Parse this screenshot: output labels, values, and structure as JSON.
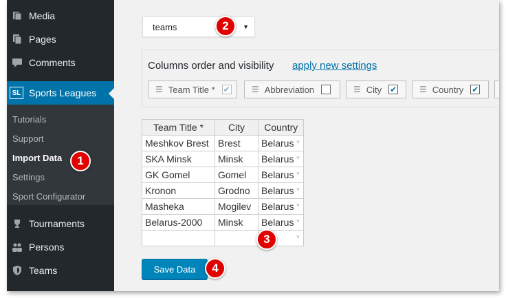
{
  "sidebar": {
    "menu": [
      {
        "label": "Media",
        "icon": "media-icon"
      },
      {
        "label": "Pages",
        "icon": "pages-icon"
      },
      {
        "label": "Comments",
        "icon": "comments-icon"
      },
      {
        "label": "Sports Leagues",
        "icon": "sl-logo-icon",
        "badge": "SL",
        "active": true
      }
    ],
    "submenu": [
      "Tutorials",
      "Support",
      "Import Data",
      "Settings",
      "Sport Configurator"
    ],
    "current_submenu": "Import Data",
    "menu_bottom": [
      {
        "label": "Tournaments",
        "icon": "trophy-icon"
      },
      {
        "label": "Persons",
        "icon": "persons-icon"
      },
      {
        "label": "Teams",
        "icon": "shield-icon"
      }
    ]
  },
  "import": {
    "type_select": {
      "value": "teams"
    },
    "columns_panel": {
      "title": "Columns order and visibility",
      "apply_link": "apply new settings",
      "columns": [
        {
          "label": "Team Title *",
          "checked": true,
          "disabled": true
        },
        {
          "label": "Abbreviation",
          "checked": false
        },
        {
          "label": "City",
          "checked": true
        },
        {
          "label": "Country",
          "checked": true
        }
      ]
    },
    "table": {
      "headers": [
        "Team Title *",
        "City",
        "Country"
      ],
      "rows": [
        [
          "Meshkov Brest",
          "Brest",
          "Belarus"
        ],
        [
          "SKA Minsk",
          "Minsk",
          "Belarus"
        ],
        [
          "GK Gomel",
          "Gomel",
          "Belarus"
        ],
        [
          "Kronon",
          "Grodno",
          "Belarus"
        ],
        [
          "Masheka",
          "Mogilev",
          "Belarus"
        ],
        [
          "Belarus-2000",
          "Minsk",
          "Belarus"
        ],
        [
          "",
          "",
          ""
        ]
      ]
    },
    "save_button": "Save Data"
  },
  "markers": [
    "1",
    "2",
    "3",
    "4"
  ],
  "colors": {
    "sidebar_bg": "#23282d",
    "accent": "#0073aa",
    "marker": "#e00000"
  }
}
